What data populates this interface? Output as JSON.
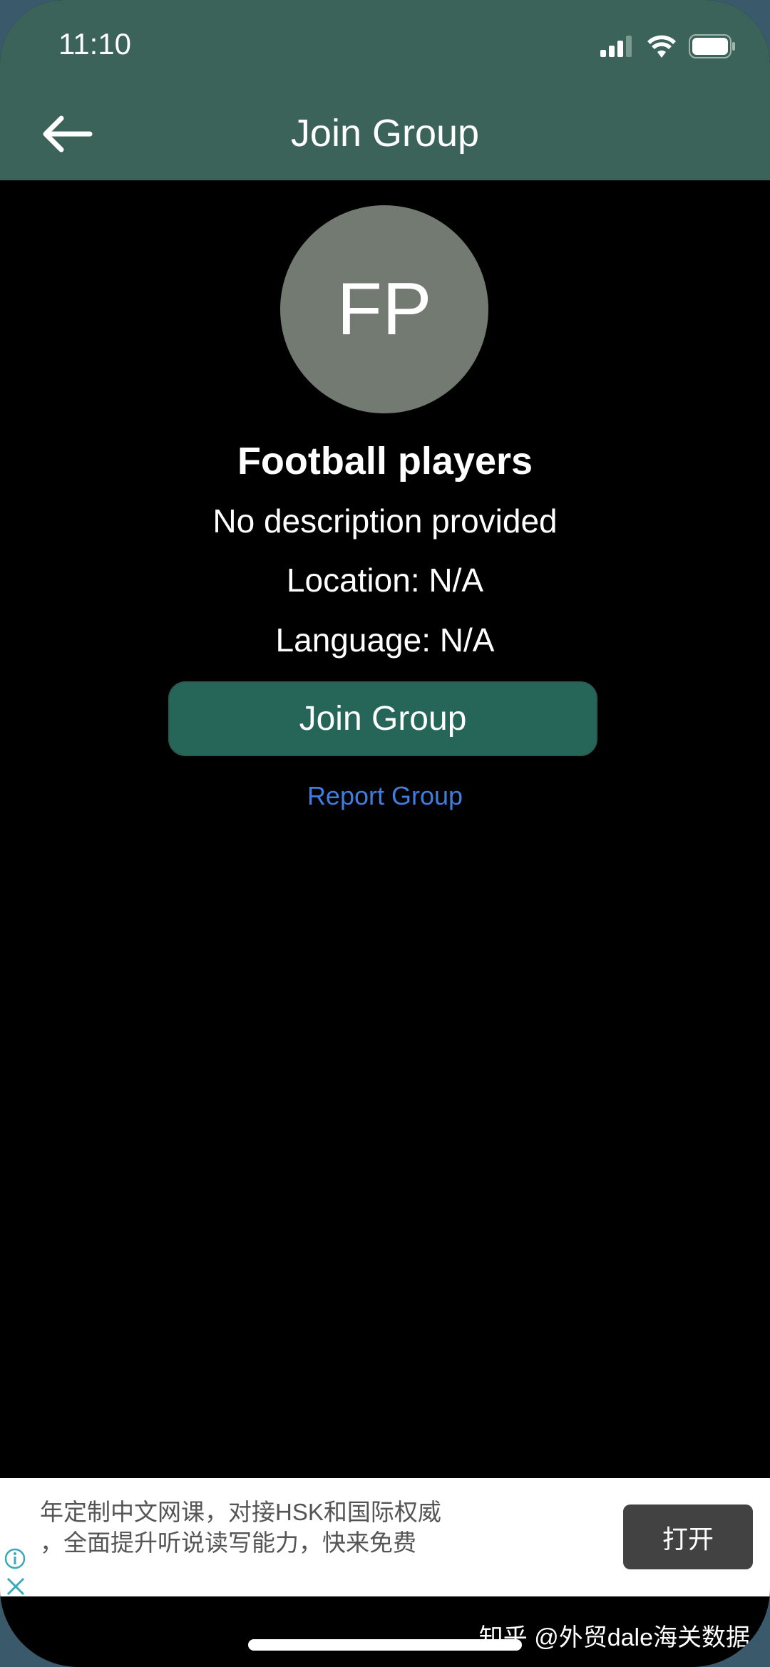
{
  "status_bar": {
    "time": "11:10",
    "icons": [
      "cellular-signal-icon",
      "wifi-icon",
      "battery-icon"
    ]
  },
  "header": {
    "title": "Join Group",
    "back_icon": "arrow-left-icon"
  },
  "group": {
    "initials": "FP",
    "name": "Football players",
    "description": "No description provided",
    "location": "Location: N/A",
    "language": "Language: N/A"
  },
  "actions": {
    "join_label": "Join Group",
    "report_label": "Report Group"
  },
  "ad": {
    "text_line1": "年定制中文网课，对接HSK和国际权威",
    "text_line2": "，全面提升听说读写能力，快来免费",
    "open_label": "打开"
  },
  "watermark": "知乎 @外贸dale海关数据",
  "colors": {
    "header": "#3c635a",
    "button": "#256658",
    "avatar": "#737a71",
    "link": "#3f7ee0"
  }
}
